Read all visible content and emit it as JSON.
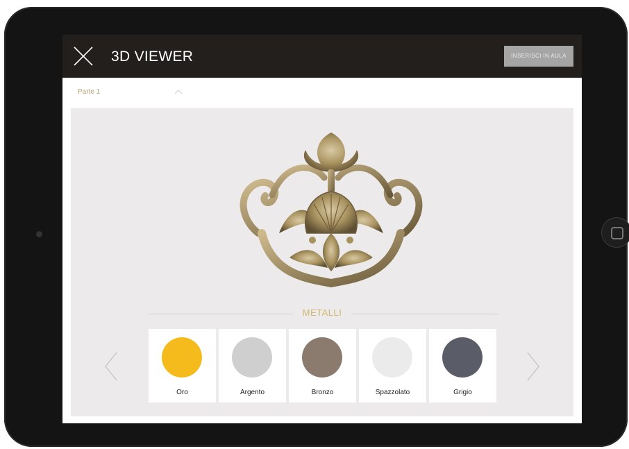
{
  "header": {
    "title": "3D VIEWER",
    "ar_button_label": "inserisci in aula"
  },
  "part_selector": {
    "label": "Parte 1"
  },
  "materials": {
    "section_title": "METALLI",
    "swatches": [
      {
        "label": "Oro",
        "color": "#f5bb1c"
      },
      {
        "label": "Argento",
        "color": "#cfcfcf"
      },
      {
        "label": "Bronzo",
        "color": "#8b7a6e"
      },
      {
        "label": "Spazzolato",
        "color": "#ebebeb"
      },
      {
        "label": "Grigio",
        "color": "#5a5d68"
      }
    ]
  },
  "colors": {
    "topbar": "#231f1d",
    "accent_gold": "#d2b772",
    "viewer_bg": "#eceaea"
  },
  "icons": [
    "close-icon",
    "chevron-up-icon",
    "chevron-left-icon",
    "chevron-right-icon"
  ]
}
